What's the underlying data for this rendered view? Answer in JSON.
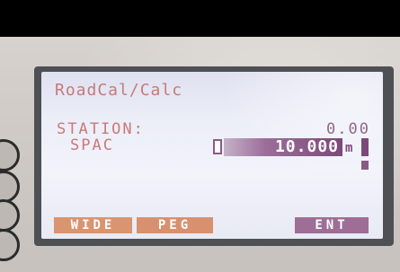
{
  "screen": {
    "title": "RoadCal/Calc",
    "station_label": "STATION:",
    "station_value": "0.00",
    "spac_label": "SPAC",
    "spac_value": "10.000",
    "spac_unit": "m"
  },
  "softkeys": {
    "wide": "WIDE",
    "peg": "PEG",
    "ent": "ENT"
  },
  "colors": {
    "lcd_text": "#c77a7a",
    "highlight": "#7c4a78",
    "softkey_orange": "#d99470",
    "softkey_purple": "#9e6e96",
    "screen_background": "#eceef8"
  }
}
